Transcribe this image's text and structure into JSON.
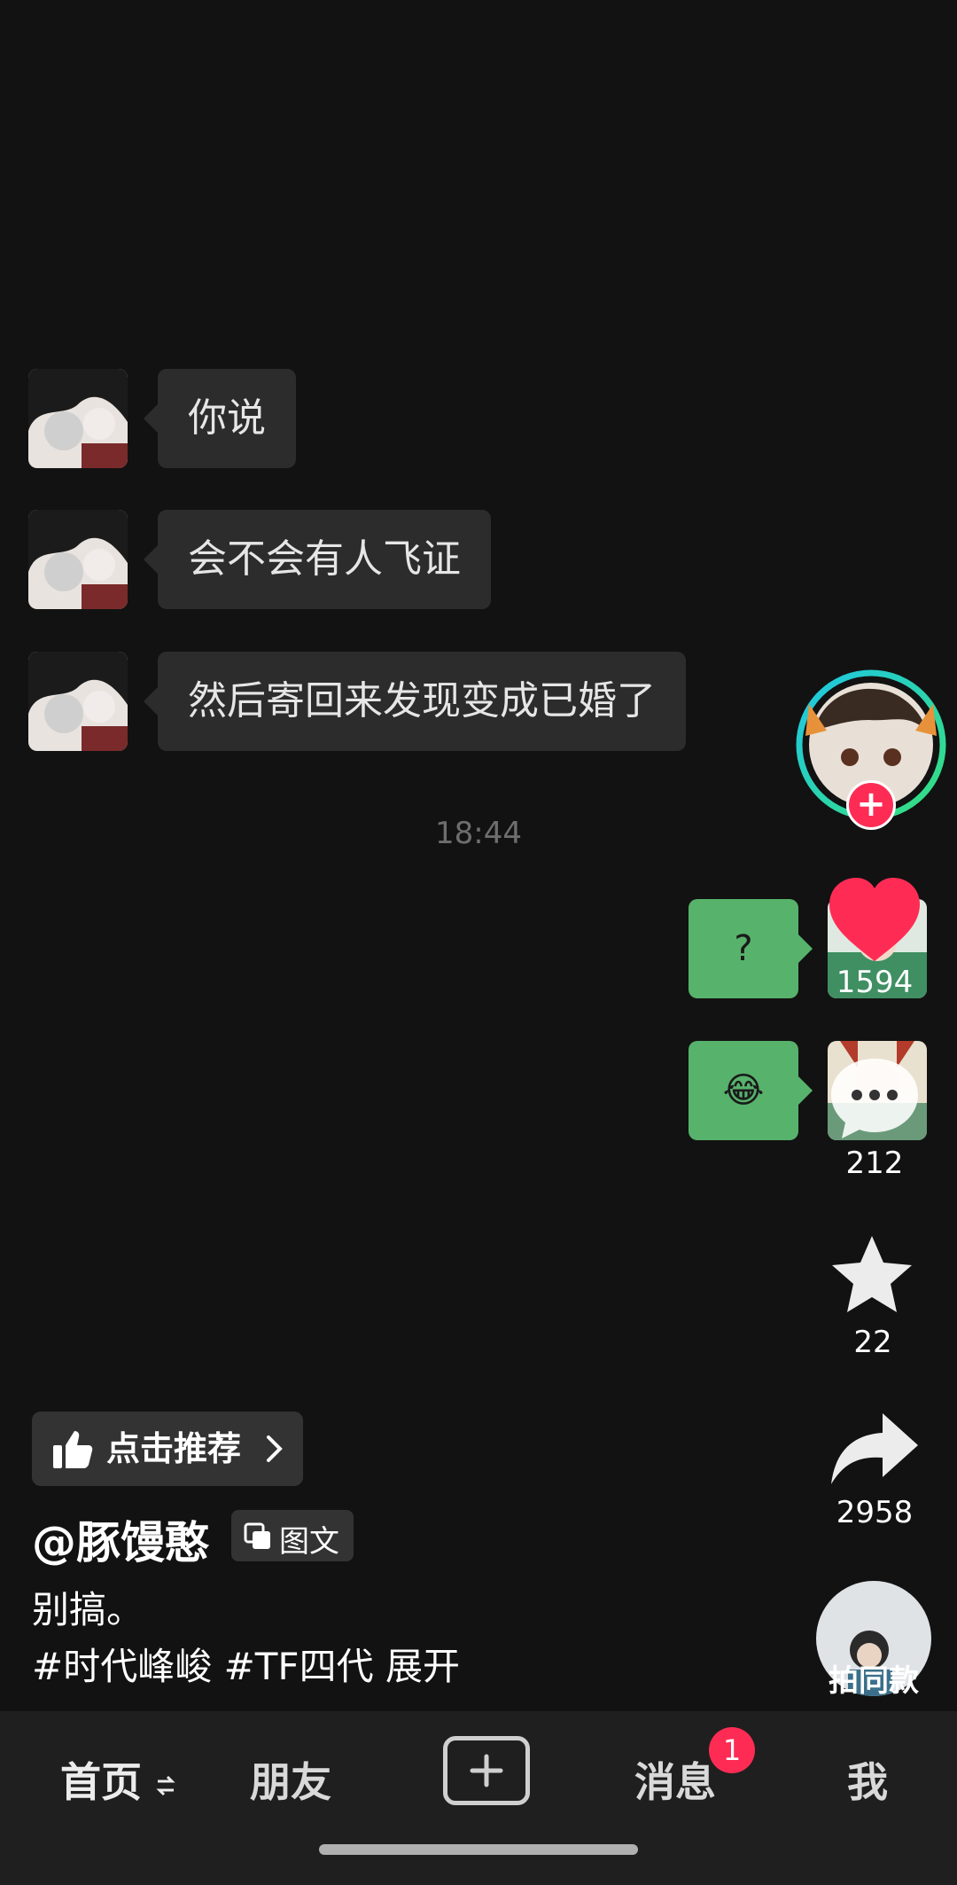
{
  "chat": {
    "left_messages": [
      "你说",
      "会不会有人飞证",
      "然后寄回来发现变成已婚了"
    ],
    "timestamp": "18:44",
    "right_messages": [
      "?",
      "😂"
    ]
  },
  "rail": {
    "like_count": "1594",
    "comment_count": "212",
    "favorite_count": "22",
    "share_count": "2958",
    "same_style_label": "拍同款",
    "follow_symbol": "+"
  },
  "post": {
    "recommend_label": "点击推荐",
    "author": "@豚馒憨",
    "type_label": "图文",
    "caption_line1": "别搞。",
    "hashtag1": "#时代峰峻",
    "hashtag2": "#TF四代",
    "expand_label": "展开"
  },
  "nav": {
    "home": "首页",
    "friends": "朋友",
    "messages": "消息",
    "messages_badge": "1",
    "me": "我"
  },
  "colors": {
    "background": "#121212",
    "bubble_left": "#2c2c2c",
    "bubble_right": "#57b26c",
    "like_red": "#fe2c55",
    "badge_red": "#fe2c55"
  },
  "icons": [
    "thumbs-up-icon",
    "chevron-right-icon",
    "copy-icon",
    "heart-icon",
    "comment-icon",
    "star-icon",
    "share-icon",
    "plus-icon",
    "swap-icon"
  ]
}
